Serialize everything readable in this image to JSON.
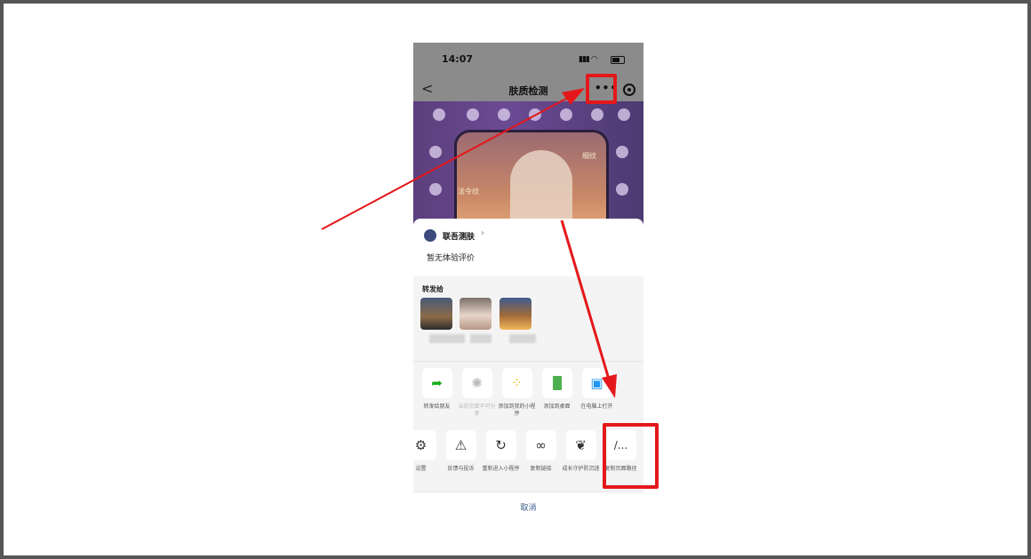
{
  "status_bar": {
    "time": "14:07"
  },
  "nav": {
    "back": "<",
    "title": "肤质检测",
    "more": "•••"
  },
  "banner": {
    "tag_left": "法令纹",
    "tag_right": "细纹"
  },
  "miniprogram": {
    "name": "联吾测肤",
    "review": "暂无体验评价"
  },
  "share": {
    "label": "转发给"
  },
  "row1": [
    {
      "label": "转发给朋友",
      "icon": "forward-icon"
    },
    {
      "label": "当前页面不可分享",
      "icon": "loading-icon"
    },
    {
      "label": "添加到我的小程序",
      "icon": "mini-program-icon"
    },
    {
      "label": "添加到桌面",
      "icon": "add-to-desktop-icon"
    },
    {
      "label": "在电脑上打开",
      "icon": "computer-icon"
    }
  ],
  "row2": [
    {
      "label": "设置",
      "icon": "gear-icon"
    },
    {
      "label": "反馈与投诉",
      "icon": "warning-icon"
    },
    {
      "label": "重新进入小程序",
      "icon": "reload-icon"
    },
    {
      "label": "复制链接",
      "icon": "link-icon"
    },
    {
      "label": "成长守护防沉迷",
      "icon": "sprout-icon"
    },
    {
      "label": "复制页面路径",
      "icon": "path-icon"
    }
  ],
  "cancel": "取消",
  "colors": {
    "highlight": "#e4181b",
    "overlay": "#8b8b8b",
    "link": "#3a5b8c"
  }
}
